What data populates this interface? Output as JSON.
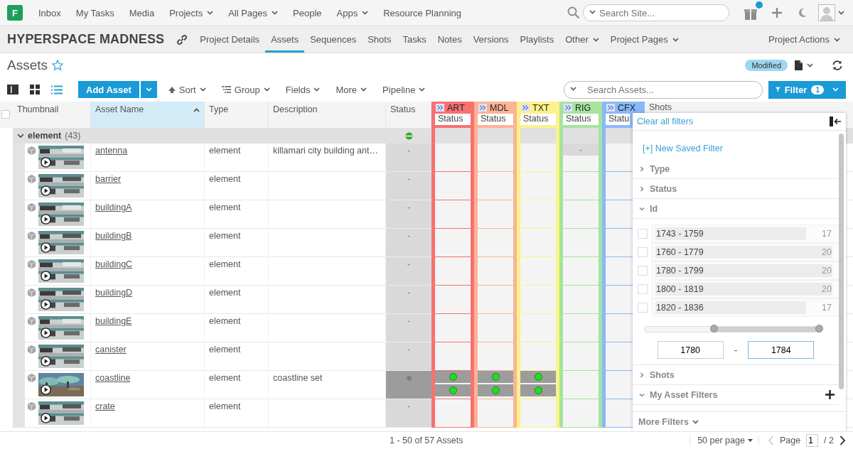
{
  "top_nav": {
    "logo": "F",
    "items": [
      {
        "label": "Inbox",
        "dropdown": false
      },
      {
        "label": "My Tasks",
        "dropdown": false
      },
      {
        "label": "Media",
        "dropdown": false
      },
      {
        "label": "Projects",
        "dropdown": true
      },
      {
        "label": "All Pages",
        "dropdown": true
      },
      {
        "label": "People",
        "dropdown": false
      },
      {
        "label": "Apps",
        "dropdown": true
      },
      {
        "label": "Resource Planning",
        "dropdown": false
      }
    ],
    "search": {
      "placeholder": "Search Site..."
    },
    "notification": true
  },
  "project_bar": {
    "title": "HYPERSPACE MADNESS",
    "tabs": [
      {
        "label": "Project Details",
        "selected": false,
        "dropdown": false
      },
      {
        "label": "Assets",
        "selected": true,
        "dropdown": false
      },
      {
        "label": "Sequences",
        "selected": false,
        "dropdown": false
      },
      {
        "label": "Shots",
        "selected": false,
        "dropdown": false
      },
      {
        "label": "Tasks",
        "selected": false,
        "dropdown": false
      },
      {
        "label": "Notes",
        "selected": false,
        "dropdown": false
      },
      {
        "label": "Versions",
        "selected": false,
        "dropdown": false
      },
      {
        "label": "Playlists",
        "selected": false,
        "dropdown": false
      },
      {
        "label": "Other",
        "selected": false,
        "dropdown": true
      },
      {
        "label": "Project Pages",
        "selected": false,
        "dropdown": true
      }
    ],
    "actions": "Project Actions"
  },
  "page": {
    "title": "Assets",
    "favorite": false,
    "badge": "Modified"
  },
  "toolbar": {
    "views": [
      {
        "kind": "detail",
        "selected": false
      },
      {
        "kind": "grid",
        "selected": false
      },
      {
        "kind": "list",
        "selected": true
      }
    ],
    "add_button": "Add Asset",
    "menus": [
      {
        "label": "Sort",
        "kind": "sort"
      },
      {
        "label": "Group",
        "kind": "group"
      },
      {
        "label": "Fields",
        "kind": "plain"
      },
      {
        "label": "More",
        "kind": "plain"
      },
      {
        "label": "Pipeline",
        "kind": "plain"
      }
    ],
    "search": {
      "placeholder": "Search Assets..."
    },
    "filter": {
      "label": "Filter",
      "count": "1"
    }
  },
  "table": {
    "select_all": false,
    "columns": [
      {
        "label": "Thumbnail",
        "sorted": false
      },
      {
        "label": "Asset Name",
        "sorted": true
      },
      {
        "label": "Type",
        "sorted": false
      },
      {
        "label": "Description",
        "sorted": false
      },
      {
        "label": "Status",
        "sorted": false
      }
    ],
    "steps": [
      {
        "label": "ART",
        "field": "Status",
        "color": "#f87171"
      },
      {
        "label": "MDL",
        "field": "Status",
        "color": "#fbb394"
      },
      {
        "label": "TXT",
        "field": "Status",
        "color": "#fbf28a"
      },
      {
        "label": "RIG",
        "field": "Status",
        "color": "#a6e3a0"
      },
      {
        "label": "CFX",
        "field": "Statu",
        "color": "#8ab8f8"
      }
    ],
    "extra_column": "Shots",
    "group": {
      "label": "element",
      "count": "(43)",
      "expanded": true
    },
    "rows": [
      {
        "name": "antenna",
        "type": "element",
        "description": "killamari city building ant…",
        "status": {
          "kind": "dash",
          "text": "-"
        },
        "tasks": [
          {
            "kind": "empty"
          },
          {
            "kind": "empty"
          },
          {
            "kind": "empty"
          },
          {
            "kind": "dash",
            "text": "-"
          }
        ]
      },
      {
        "name": "barrier",
        "type": "element",
        "status": {
          "kind": "dash",
          "text": "-"
        }
      },
      {
        "name": "buildingA",
        "type": "element",
        "status": {
          "kind": "dash",
          "text": "-"
        }
      },
      {
        "name": "buildingB",
        "type": "element",
        "status": {
          "kind": "dash",
          "text": "-"
        }
      },
      {
        "name": "buildingC",
        "type": "element",
        "status": {
          "kind": "dash",
          "text": "-"
        }
      },
      {
        "name": "buildingD",
        "type": "element",
        "status": {
          "kind": "dash",
          "text": "-"
        }
      },
      {
        "name": "buildingE",
        "type": "element",
        "status": {
          "kind": "dash",
          "text": "-"
        }
      },
      {
        "name": "canister",
        "type": "element",
        "status": {
          "kind": "dash",
          "text": "-"
        }
      },
      {
        "name": "coastline",
        "type": "element",
        "description": "coastline set",
        "status": {
          "kind": "dot",
          "color": "#808080"
        },
        "tasks": [
          {
            "kind": "dots",
            "dots": [
              {
                "color": "#22dd22"
              },
              {
                "color": "#22dd22"
              }
            ]
          },
          {
            "kind": "dots",
            "dots": [
              {
                "color": "#22dd22"
              },
              {
                "color": "#22dd22"
              }
            ]
          },
          {
            "kind": "dots",
            "dots": [
              {
                "color": "#22dd22"
              },
              {
                "color": "#22dd22"
              }
            ]
          }
        ]
      },
      {
        "name": "crate",
        "type": "element",
        "status": {
          "kind": "dash",
          "text": "-"
        }
      }
    ]
  },
  "filter_panel": {
    "clear": "Clear all filters",
    "new_saved": "[+] New Saved Filter",
    "sections": [
      {
        "title": "Type",
        "expanded": false
      },
      {
        "title": "Status",
        "expanded": false
      },
      {
        "title": "Id",
        "expanded": true,
        "options": [
          {
            "label": "1743 - 1759",
            "count": "17",
            "checked": false,
            "level": 0.85
          },
          {
            "label": "1760 - 1779",
            "count": "20",
            "checked": false,
            "level": 1
          },
          {
            "label": "1780 - 1799",
            "count": "20",
            "checked": false,
            "level": 1
          },
          {
            "label": "1800 - 1819",
            "count": "20",
            "checked": false,
            "level": 1
          },
          {
            "label": "1820 - 1836",
            "count": "17",
            "checked": false,
            "level": 0.85
          }
        ],
        "range": {
          "low": {
            "level": 0.4,
            "value": "1780"
          },
          "separator": "-",
          "high": {
            "level": 1,
            "value": "1784"
          }
        }
      },
      {
        "title": "Shots",
        "expanded": false
      },
      {
        "title": "My Asset Filters",
        "expanded": true,
        "addable": true
      }
    ],
    "more": "More Filters"
  },
  "footer": {
    "summary": "1 - 50 of 57 Assets",
    "per_page": "50 per page",
    "page_label": "Page",
    "page": "1",
    "pages": "/ 2"
  }
}
